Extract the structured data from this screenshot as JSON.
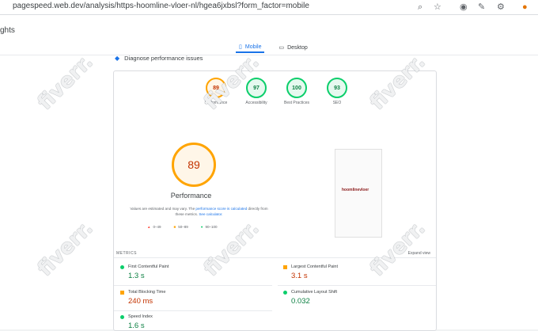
{
  "browser": {
    "url": "pagespeed.web.dev/analysis/https-hoomline-vloer-nl/hgea6jxbsl?form_factor=mobile"
  },
  "page": {
    "heading_fragment": "ghts",
    "tabs": [
      {
        "label": "Mobile"
      },
      {
        "label": "Desktop"
      }
    ],
    "diagnose_label": "Diagnose performance issues",
    "scores": [
      {
        "value": "89",
        "label": "Performance",
        "color": "#ffa400"
      },
      {
        "value": "97",
        "label": "Accessibility",
        "color": "#0cce6b"
      },
      {
        "value": "100",
        "label": "Best Practices",
        "color": "#0cce6b"
      },
      {
        "value": "93",
        "label": "SEO",
        "color": "#0cce6b"
      }
    ],
    "main_score": {
      "value": "89",
      "title": "Performance"
    },
    "note": {
      "pre": "Values are estimated and may vary. The ",
      "link1": "performance score is calculated",
      "mid": " directly from these metrics. ",
      "link2": "See calculator."
    },
    "legend": [
      {
        "symbol": "▲",
        "text": "0–49",
        "color": "#ff4e42"
      },
      {
        "symbol": "■",
        "text": "50–89",
        "color": "#ffa400"
      },
      {
        "symbol": "●",
        "text": "90–100",
        "color": "#0cce6b"
      }
    ],
    "screenshot_logo": "hoomlinevloer",
    "metrics_header": "METRICS",
    "expand_label": "Expand view",
    "metrics": [
      {
        "name": "First Contentful Paint",
        "value": "1.3 s",
        "status": "good"
      },
      {
        "name": "Largest Contentful Paint",
        "value": "3.1 s",
        "status": "average"
      },
      {
        "name": "Total Blocking Time",
        "value": "240 ms",
        "status": "average"
      },
      {
        "name": "Cumulative Layout Shift",
        "value": "0.032",
        "status": "good"
      },
      {
        "name": "Speed Index",
        "value": "1.6 s",
        "status": "good"
      }
    ],
    "watermark": "fiverr."
  }
}
